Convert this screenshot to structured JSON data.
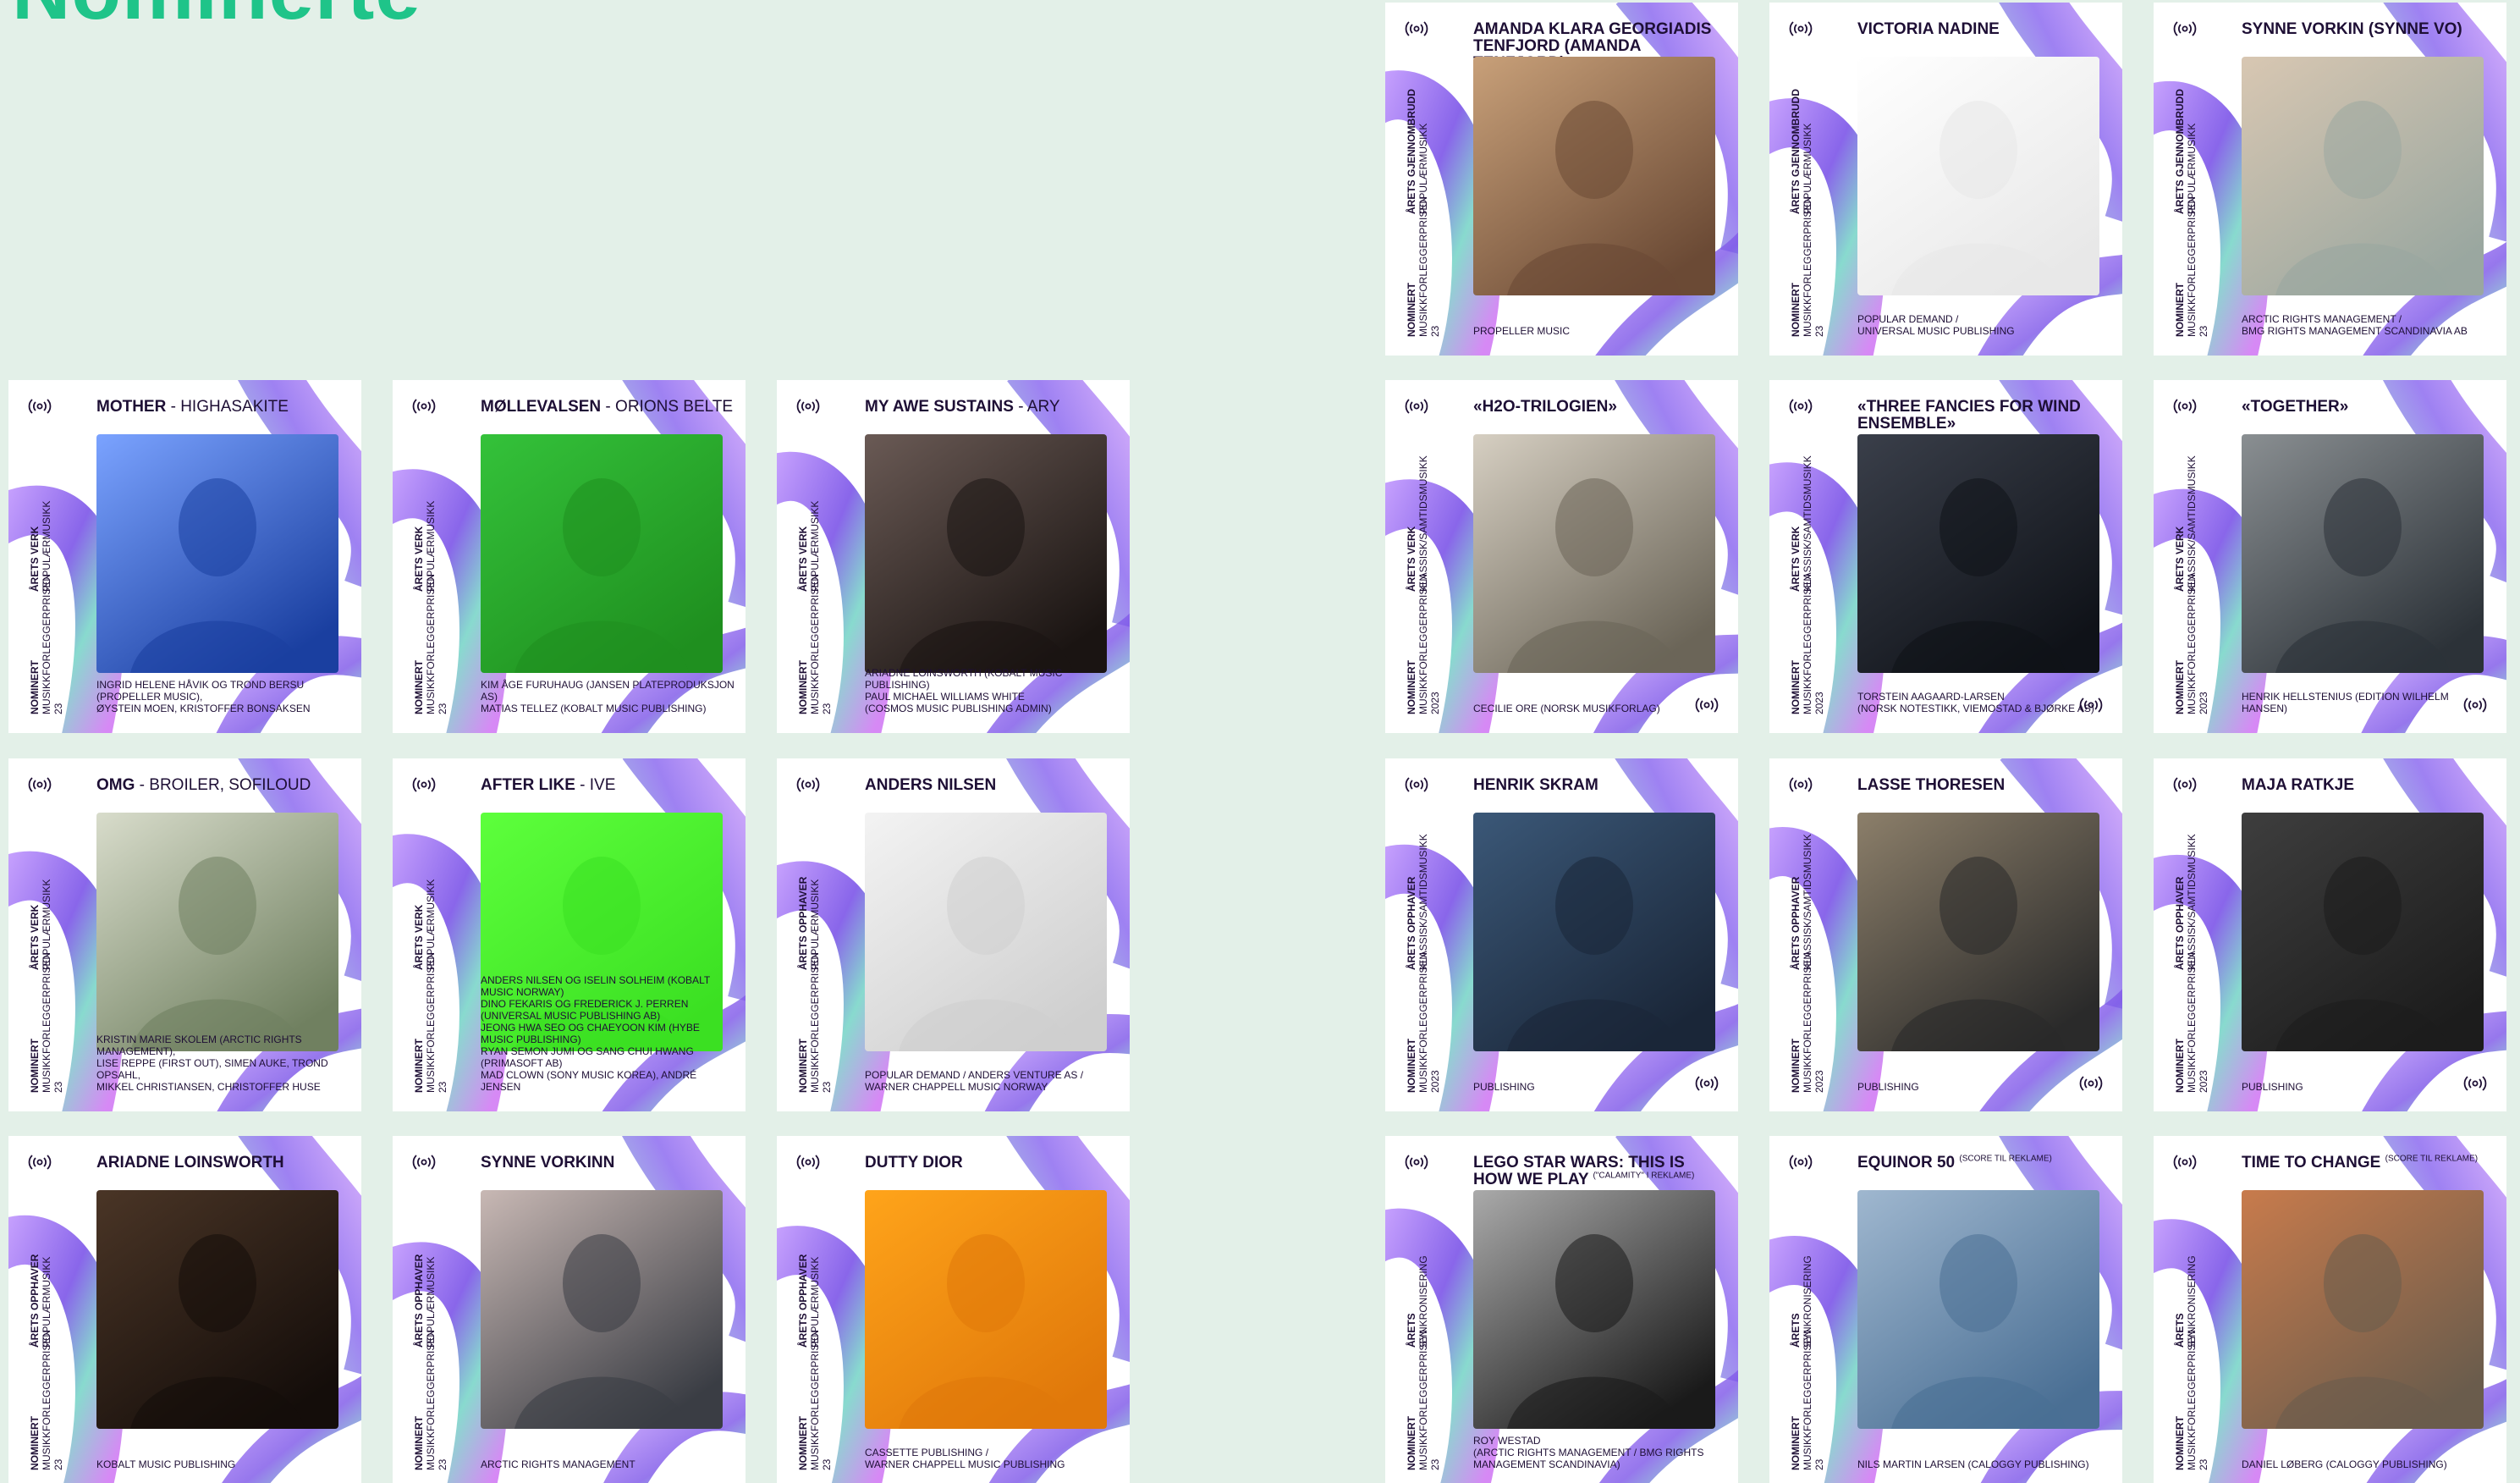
{
  "page": {
    "title": "Nominerte"
  },
  "labels": {
    "nominert": "Nominert",
    "prize_caps": "Musikkforleggerprisen 23",
    "prize_lower": "Musikkforleggerprisen 2023"
  },
  "colors": {
    "accent": "#1fc489",
    "ink": "#1e0f35",
    "background": "#e3f0e8"
  },
  "icons": {
    "broadcast": "broadcast-icon"
  },
  "cards": [
    {
      "title": "Amanda Klara Georgiadis Tenfjord (Amanda Tenfjord)",
      "subtitle": "",
      "note": "",
      "cat1": "Årets gjennombrudd",
      "cat2": "Populærmusikk",
      "credits": [
        "Propeller Music"
      ]
    },
    {
      "title": "Victoria Nadine",
      "subtitle": "",
      "note": "",
      "cat1": "Årets gjennombrudd",
      "cat2": "Populærmusikk",
      "credits": [
        "Popular Demand /",
        "Universal Music Publishing"
      ]
    },
    {
      "title": "Synne Vorkin (Synne Vo)",
      "subtitle": "",
      "note": "",
      "cat1": "Årets gjennombrudd",
      "cat2": "Populærmusikk",
      "credits": [
        "Arctic Rights Management /",
        "BMG Rights Management Scandinavia AB"
      ]
    },
    {
      "title": "Mother",
      "subtitle": " - Highasakite",
      "note": "",
      "cat1": "Årets verk",
      "cat2": "Populærmusikk",
      "credits": [
        "Ingrid Helene Håvik og Trond Bersu (Propeller Music),",
        "Øystein Moen, Kristoffer Bonsaksen"
      ]
    },
    {
      "title": "Møllevalsen",
      "subtitle": " - Orions Belte",
      "note": "",
      "cat1": "Årets verk",
      "cat2": "Populærmusikk",
      "credits": [
        "Kim Åge Furuhaug (Jansen Plateproduksjon AS)",
        "Matias Tellez (Kobalt Music Publishing)"
      ]
    },
    {
      "title": "My Awe Sustains",
      "subtitle": " - Ary",
      "note": "",
      "cat1": "Årets verk",
      "cat2": "Populærmusikk",
      "credits": [
        "Ariadne Loinsworth (Kobalt Music Publishing)",
        "Paul Michael Williams White",
        "(Cosmos Music Publishing Admin)"
      ]
    },
    {
      "title": "«H2O-trilogien»",
      "subtitle": "",
      "note": "",
      "cat1": "Årets verk",
      "cat2": "Klassisk/samtidsmusikk",
      "credits": [
        "Cecilie Ore (Norsk Musikforlag)"
      ]
    },
    {
      "title": "«Three Fancies for Wind Ensemble»",
      "subtitle": "",
      "note": "",
      "cat1": "Årets verk",
      "cat2": "Klassisk/samtidsmusikk",
      "credits": [
        "Torstein Aagaard-Larsen",
        "(Norsk Notestikk, Viemostad & Bjørke AS)"
      ]
    },
    {
      "title": "«Together»",
      "subtitle": "",
      "note": "",
      "cat1": "Årets verk",
      "cat2": "Klassisk/samtidsmusikk",
      "credits": [
        "Henrik Hellstenius (Edition Wilhelm Hansen)"
      ]
    },
    {
      "title": "OMG",
      "subtitle": " - Broiler, Sofiloud",
      "note": "",
      "cat1": "Årets verk",
      "cat2": "Populærmusikk",
      "credits": [
        "Kristin Marie Skolem (Arctic Rights Management),",
        "Lise Reppe (First Out), Simen Auke, Trond Opsahl,",
        "Mikkel Christiansen, Christoffer Huse"
      ]
    },
    {
      "title": "After Like",
      "subtitle": " - IVE",
      "note": "",
      "cat1": "Årets verk",
      "cat2": "Populærmusikk",
      "credits": [
        "Anders Nilsen og Iselin Solheim (Kobalt Music Norway)",
        "Dino Fekaris og Frederick J. Perren (Universal Music Publishing AB)",
        "Jeong Hwa Seo og Chaeyoon Kim (Hybe Music Publishing)",
        "Ryan Semon Jumi og Sang Chui Hwang (Primasoft AB)",
        "Mad Clown (Sony Music Korea), André Jensen"
      ]
    },
    {
      "title": "Anders Nilsen",
      "subtitle": "",
      "note": "",
      "cat1": "Årets opphaver",
      "cat2": "Populærmusikk",
      "credits": [
        "Popular Demand / Anders Venture AS /",
        "Warner Chappell Music Norway"
      ]
    },
    {
      "title": "Henrik Skram",
      "subtitle": "",
      "note": "",
      "cat1": "Årets opphaver",
      "cat2": "Klassisk/samtidsmusikk",
      "credits": [
        "Publishing"
      ]
    },
    {
      "title": "Lasse Thoresen",
      "subtitle": "",
      "note": "",
      "cat1": "Årets opphaver",
      "cat2": "Klassisk/samtidsmusikk",
      "credits": [
        "Publishing"
      ]
    },
    {
      "title": "Maja Ratkje",
      "subtitle": "",
      "note": "",
      "cat1": "Årets opphaver",
      "cat2": "Klassisk/samtidsmusikk",
      "credits": [
        "Publishing"
      ]
    },
    {
      "title": "Ariadne Loinsworth",
      "subtitle": "",
      "note": "",
      "cat1": "Årets opphaver",
      "cat2": "Populærmusikk",
      "credits": [
        "Kobalt Music Publishing"
      ]
    },
    {
      "title": "Synne Vorkinn",
      "subtitle": "",
      "note": "",
      "cat1": "Årets opphaver",
      "cat2": "Populærmusikk",
      "credits": [
        "Arctic Rights Management"
      ]
    },
    {
      "title": "Dutty Dior",
      "subtitle": "",
      "note": "",
      "cat1": "Årets opphaver",
      "cat2": "Populærmusikk",
      "credits": [
        "Cassette Publishing /",
        "Warner Chappell Music Publishing"
      ]
    },
    {
      "title": "Lego Star Wars: This is how we play",
      "subtitle": "",
      "note": "(\"Calamity\" i reklame)",
      "cat1": "Årets",
      "cat2": "Synkronisering",
      "credits": [
        "Roy Westad",
        "(Arctic Rights Management / BMG Rights Management Scandinavia)"
      ]
    },
    {
      "title": "Equinor 50",
      "subtitle": "",
      "note": "(score til reklame)",
      "cat1": "Årets",
      "cat2": "Synkronisering",
      "credits": [
        "Nils Martin Larsen (Caloggy Publishing)"
      ]
    },
    {
      "title": "Time to change",
      "subtitle": "",
      "note": "(score til reklame)",
      "cat1": "Årets",
      "cat2": "Synkronisering",
      "credits": [
        "Daniel Løberg (Caloggy Publishing)"
      ]
    }
  ]
}
